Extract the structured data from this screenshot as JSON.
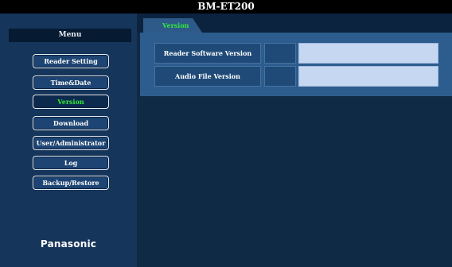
{
  "window": {
    "title": "BM-ET200"
  },
  "sidebar": {
    "header": "Menu",
    "items": [
      {
        "label": "Reader Setting"
      },
      {
        "label": "Time&Date"
      },
      {
        "label": "Version"
      },
      {
        "label": "Download"
      },
      {
        "label": "User/Administrator"
      },
      {
        "label": "Log"
      },
      {
        "label": "Backup/Restore"
      }
    ],
    "active_item": "Version",
    "logo": "Panasonic"
  },
  "main": {
    "tab": {
      "label": "Version"
    },
    "rows": [
      {
        "label": "Reader Software Version",
        "value": ""
      },
      {
        "label": "Audio File Version",
        "value": ""
      }
    ]
  },
  "colors": {
    "title_bar": "#000000",
    "sidebar_bg": "#15355a",
    "content_bg": "#0f2a44",
    "active_text": "#32e83a",
    "value_box": "#c5d7f1"
  }
}
